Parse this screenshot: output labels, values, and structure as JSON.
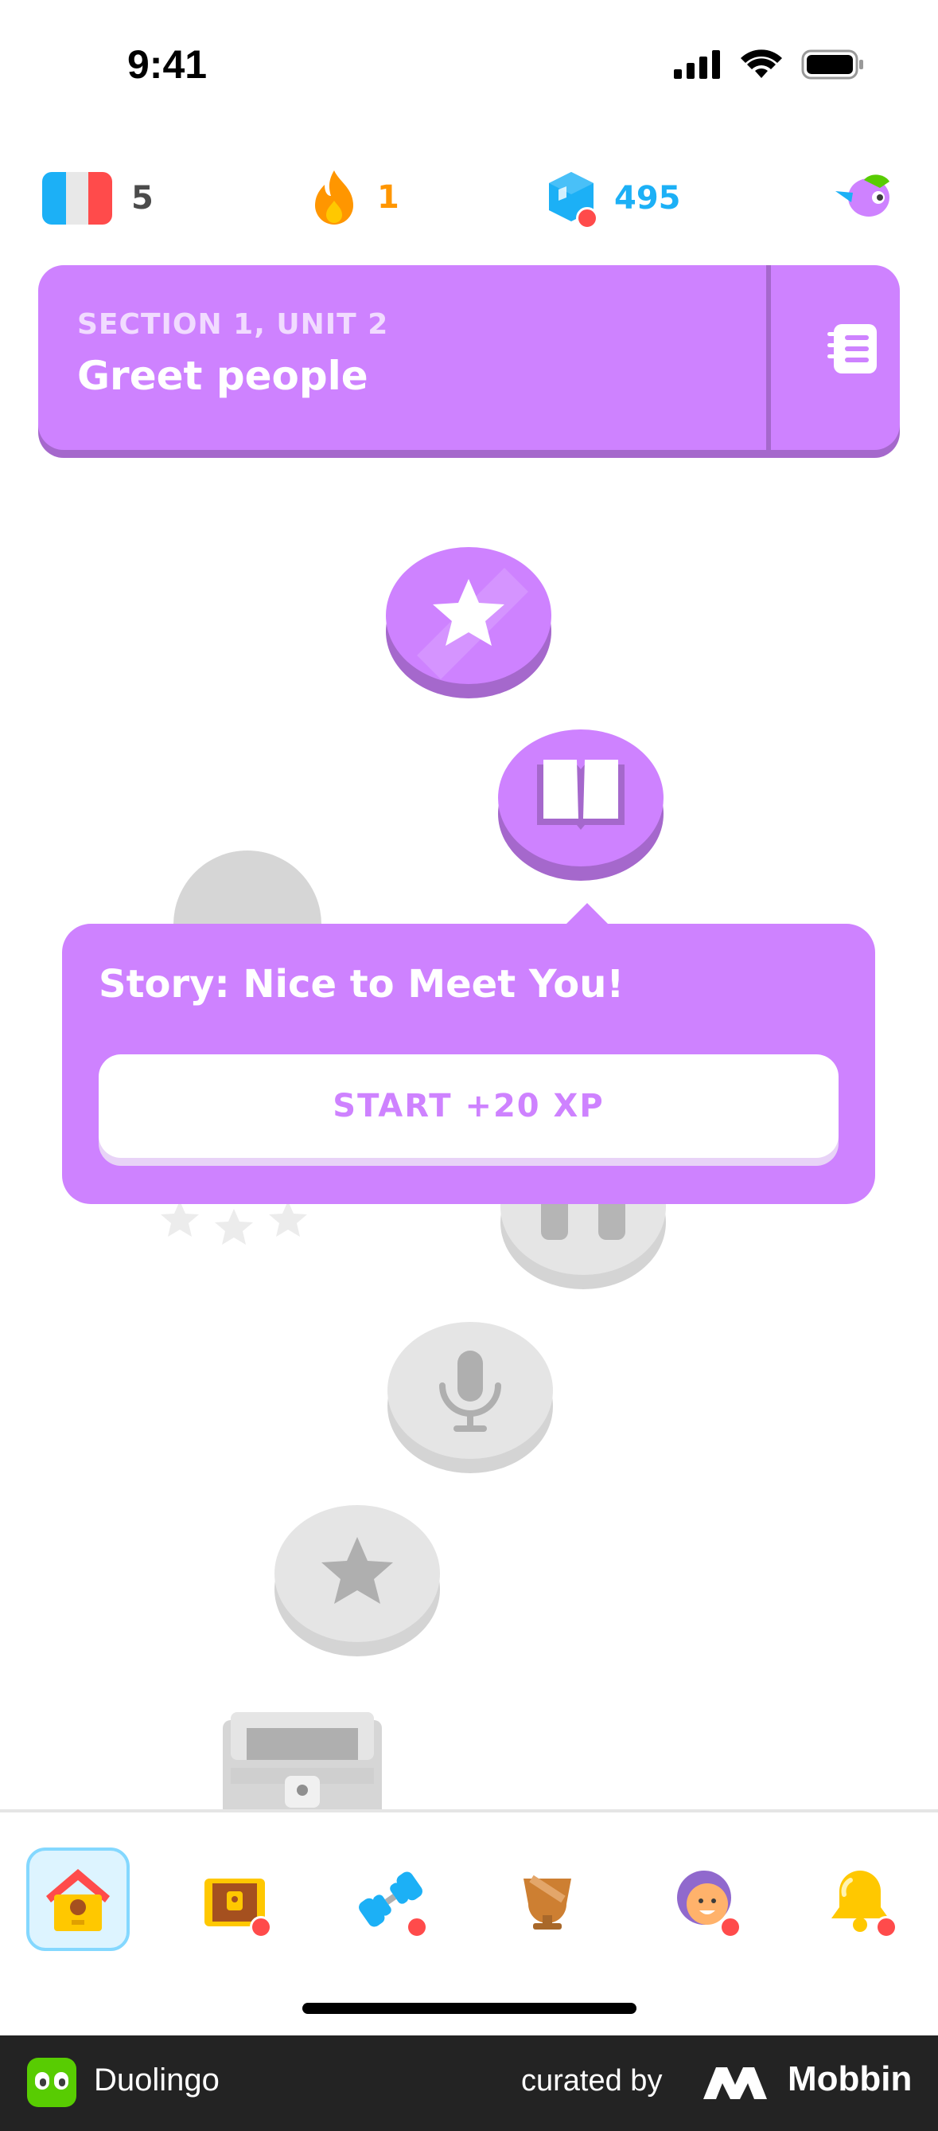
{
  "status_bar": {
    "time": "9:41"
  },
  "stats": {
    "language_flag": "french-flag-icon",
    "crowns": "5",
    "streak": "1",
    "gems": "495"
  },
  "unit": {
    "section": "SECTION 1, UNIT 2",
    "title": "Greet people"
  },
  "popup": {
    "title": "Story: Nice to Meet You!",
    "button_label": "START +20 XP"
  },
  "nodes": [
    {
      "icon": "star-icon",
      "state": "completed"
    },
    {
      "icon": "book-icon",
      "state": "current"
    },
    {
      "icon": "dumbbell-icon",
      "state": "locked"
    },
    {
      "icon": "microphone-icon",
      "state": "locked"
    },
    {
      "icon": "star-icon",
      "state": "locked"
    },
    {
      "icon": "treasure-chest-icon",
      "state": "locked"
    }
  ],
  "bottom_nav": [
    {
      "name": "home",
      "icon": "home-icon",
      "active": true
    },
    {
      "name": "shop",
      "icon": "treasure-chest-icon",
      "badge": true
    },
    {
      "name": "practice",
      "icon": "dumbbell-icon",
      "badge": true
    },
    {
      "name": "leaderboard",
      "icon": "trophy-icon"
    },
    {
      "name": "profile",
      "icon": "avatar-icon",
      "badge": true
    },
    {
      "name": "notifications",
      "icon": "bell-icon",
      "badge": true
    }
  ],
  "footer": {
    "app_name": "Duolingo",
    "curated_by": "curated by",
    "brand": "Mobbin"
  },
  "colors": {
    "unit_purple": "#ce82ff",
    "unit_purple_dark": "#a568cc",
    "locked_gray": "#e5e5e5",
    "streak_orange": "#ff9600",
    "gem_blue": "#1cb0f6",
    "active_nav_bg": "#ddf4ff"
  }
}
